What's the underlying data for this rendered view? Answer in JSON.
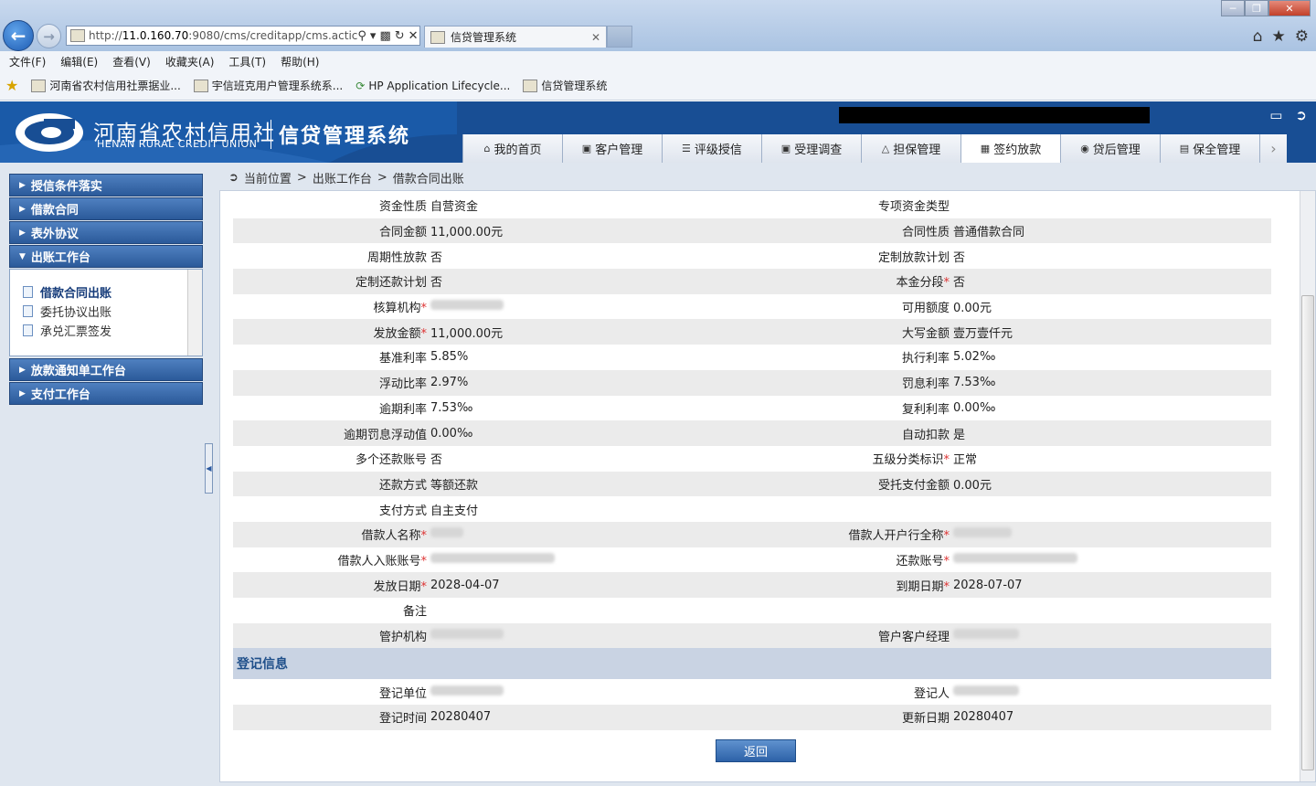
{
  "browser": {
    "url_prefix": "http://",
    "url_host": "11.0.160.70",
    "url_rest": ":9080/cms/creditapp/cms.actic",
    "tab_title": "信贷管理系统",
    "menu": [
      "文件(F)",
      "编辑(E)",
      "查看(V)",
      "收藏夹(A)",
      "工具(T)",
      "帮助(H)"
    ],
    "favorites": [
      "河南省农村信用社票据业...",
      "宇信班克用户管理系统系...",
      "HP Application Lifecycle...",
      "信贷管理系统"
    ]
  },
  "header": {
    "brand_cn": "河南省农村信用社",
    "brand_en": "HENAN RURAL CREDIT UNION",
    "system_name": "信贷管理系统"
  },
  "nav": {
    "tabs": [
      "我的首页",
      "客户管理",
      "评级授信",
      "受理调查",
      "担保管理",
      "签约放款",
      "贷后管理",
      "保全管理"
    ],
    "active": "签约放款"
  },
  "sidebar": {
    "groups": [
      "授信条件落实",
      "借款合同",
      "表外协议",
      "出账工作台"
    ],
    "sub_items": [
      "借款合同出账",
      "委托协议出账",
      "承兑汇票签发"
    ],
    "groups_after": [
      "放款通知单工作台",
      "支付工作台"
    ]
  },
  "breadcrumb": {
    "items": [
      "当前位置",
      ">",
      "出账工作台",
      ">",
      "借款合同出账"
    ]
  },
  "form": {
    "rows": [
      {
        "l1": "资金性质",
        "v1": "自营资金",
        "l2": "专项资金类型",
        "v2": ""
      },
      {
        "l1": "合同金额",
        "v1": "11,000.00元",
        "l2": "合同性质",
        "v2": "普通借款合同"
      },
      {
        "l1": "周期性放款",
        "v1": "否",
        "l2": "定制放款计划",
        "v2": "否"
      },
      {
        "l1": "定制还款计划",
        "v1": "否",
        "l2": "本金分段",
        "v2": "否"
      },
      {
        "l1": "核算机构",
        "v1": "",
        "l2": "可用额度",
        "v2": "0.00元"
      },
      {
        "l1": "发放金额",
        "v1": "11,000.00元",
        "l2": "大写金额",
        "v2": "壹万壹仟元"
      },
      {
        "l1": "基准利率",
        "v1": "5.85%",
        "l2": "执行利率",
        "v2": "5.02‰"
      },
      {
        "l1": "浮动比率",
        "v1": "2.97%",
        "l2": "罚息利率",
        "v2": "7.53‰"
      },
      {
        "l1": "逾期利率",
        "v1": "7.53‰",
        "l2": "复利利率",
        "v2": "0.00‰"
      },
      {
        "l1": "逾期罚息浮动值",
        "v1": "0.00‰",
        "l2": "自动扣款",
        "v2": "是"
      },
      {
        "l1": "多个还款账号",
        "v1": "否",
        "l2": "五级分类标识",
        "v2": "正常"
      },
      {
        "l1": "还款方式",
        "v1": "等额还款",
        "l2": "受托支付金额",
        "v2": "0.00元"
      },
      {
        "l1": "支付方式",
        "v1": "自主支付",
        "l2": "",
        "v2": ""
      },
      {
        "l1": "借款人名称",
        "v1": "",
        "l2": "借款人开户行全称",
        "v2": ""
      },
      {
        "l1": "借款人入账账号",
        "v1": "",
        "l2": "还款账号",
        "v2": ""
      },
      {
        "l1": "发放日期",
        "v1": "2028-04-07",
        "l2": "到期日期",
        "v2": "2028-07-07"
      },
      {
        "l1": "备注",
        "v1": "",
        "l2": "",
        "v2": ""
      },
      {
        "l1": "管护机构",
        "v1": "",
        "l2": "管户客户经理",
        "v2": ""
      }
    ],
    "section_title": "登记信息",
    "reg_rows": [
      {
        "l1": "登记单位",
        "v1": "",
        "l2": "登记人",
        "v2": ""
      },
      {
        "l1": "登记时间",
        "v1": "20280407",
        "l2": "更新日期",
        "v2": "20280407"
      }
    ],
    "back_label": "返回"
  }
}
